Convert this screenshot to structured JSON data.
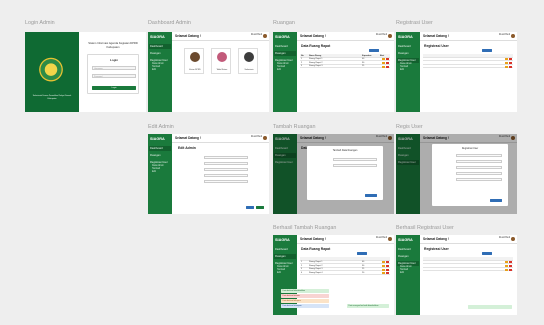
{
  "frames": {
    "login": {
      "label": "Login Admin",
      "app_title": "Sistem Informasi Agenda Kegiatan DPRD Kabupaten",
      "card_title": "Login",
      "username_placeholder": "Username",
      "password_placeholder": "Password",
      "submit_label": "Login",
      "caption": "Sekretariat Dewan Perwakilan Rakyat Daerah Kabupaten"
    },
    "dashboard": {
      "label": "Dashboard Admin",
      "cards": [
        "Ketua DPRD",
        "Wakil Ketua",
        "Sekretaris"
      ]
    },
    "ruangan": {
      "label": "Ruangan",
      "page_title": "Data Ruang Rapat"
    },
    "registrasi": {
      "label": "Registrasi User",
      "page_title": "Registrasi User"
    },
    "edit_admin": {
      "label": "Edit Admin",
      "card_title": "Edit Admin"
    },
    "tambah_ruangan": {
      "label": "Tambah Ruangan",
      "modal_title": "Tambah Data Ruangan"
    },
    "regis_user": {
      "label": "Regis User",
      "modal_title": "Registrasi User"
    },
    "berhasil_tambah": {
      "label": "Berhasil Tambah Ruangan",
      "toasts": [
        "Data berhasil ditambahkan",
        "Data berhasil diubah",
        "Data berhasil dihapus",
        "Data berhasil disimpan"
      ],
      "toast_right": "Data ruangan berhasil ditambahkan"
    },
    "berhasil_regis": {
      "label": "Berhasil Registrasi User"
    }
  },
  "common": {
    "brand": "SIAGRA",
    "greeting": "Selamat Datang !",
    "user_name": "Rusdi Budi",
    "nav": [
      "Dashboard",
      "Ruangan",
      "Registrasi User"
    ],
    "nav_sub": [
      "Data Admin",
      "Tambah",
      "Edit"
    ]
  },
  "table": {
    "headers": [
      "No",
      "Nama Ruang",
      "Kapasitas",
      "Aksi"
    ],
    "rows": [
      [
        "1",
        "Ruang Rapat 1",
        "40"
      ],
      [
        "2",
        "Ruang Rapat 2",
        "30"
      ],
      [
        "3",
        "Ruang Rapat 3",
        "25"
      ],
      [
        "4",
        "Ruang Rapat 4",
        "20"
      ]
    ]
  },
  "colors": {
    "brand_green": "#1a7a3c",
    "primary_blue": "#2f6db5",
    "edit_orange": "#e8a21a",
    "delete_red": "#d9342b"
  }
}
